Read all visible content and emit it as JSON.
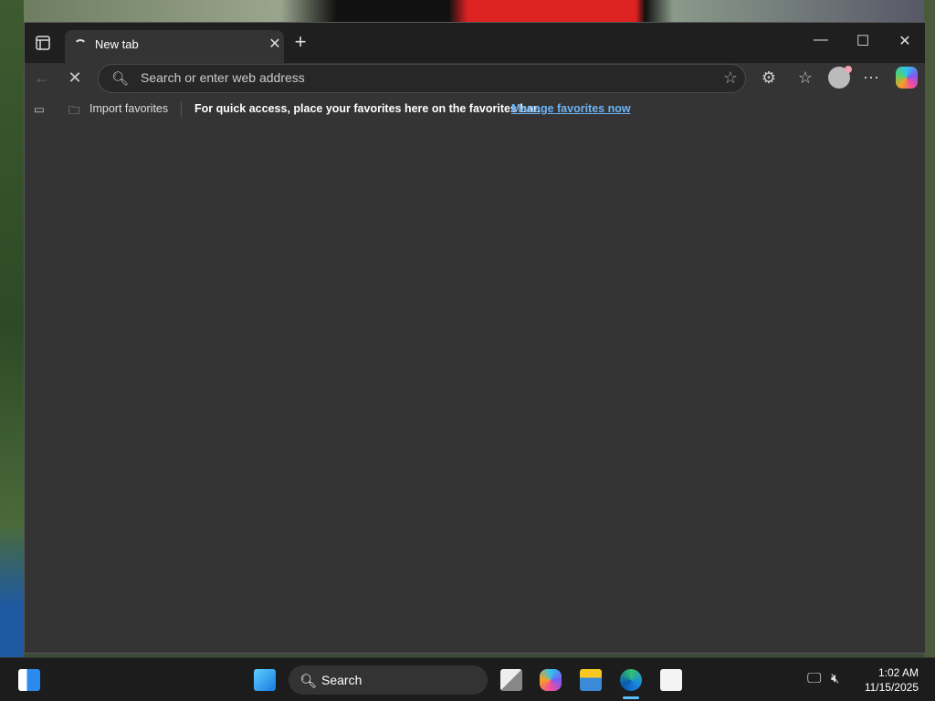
{
  "browser": {
    "tab": {
      "title": "New tab",
      "close": "✕"
    },
    "new_tab": "+",
    "window_controls": {
      "minimize": "—",
      "maximize": "☐",
      "close": "✕"
    },
    "address_bar": {
      "placeholder": "Search or enter web address",
      "value": ""
    },
    "favorites_bar": {
      "import": "Import favorites",
      "message": "For quick access, place your favorites here on the favorites bar.",
      "manage_link": "Manage favorites now"
    },
    "accent_link_color": "#6cb4f7"
  },
  "taskbar": {
    "search_label": "Search",
    "time": "1:02 AM",
    "date": "11/15/2025",
    "apps": [
      "widgets",
      "start",
      "search",
      "task-view",
      "copilot",
      "file-explorer",
      "edge",
      "microsoft-store"
    ]
  }
}
